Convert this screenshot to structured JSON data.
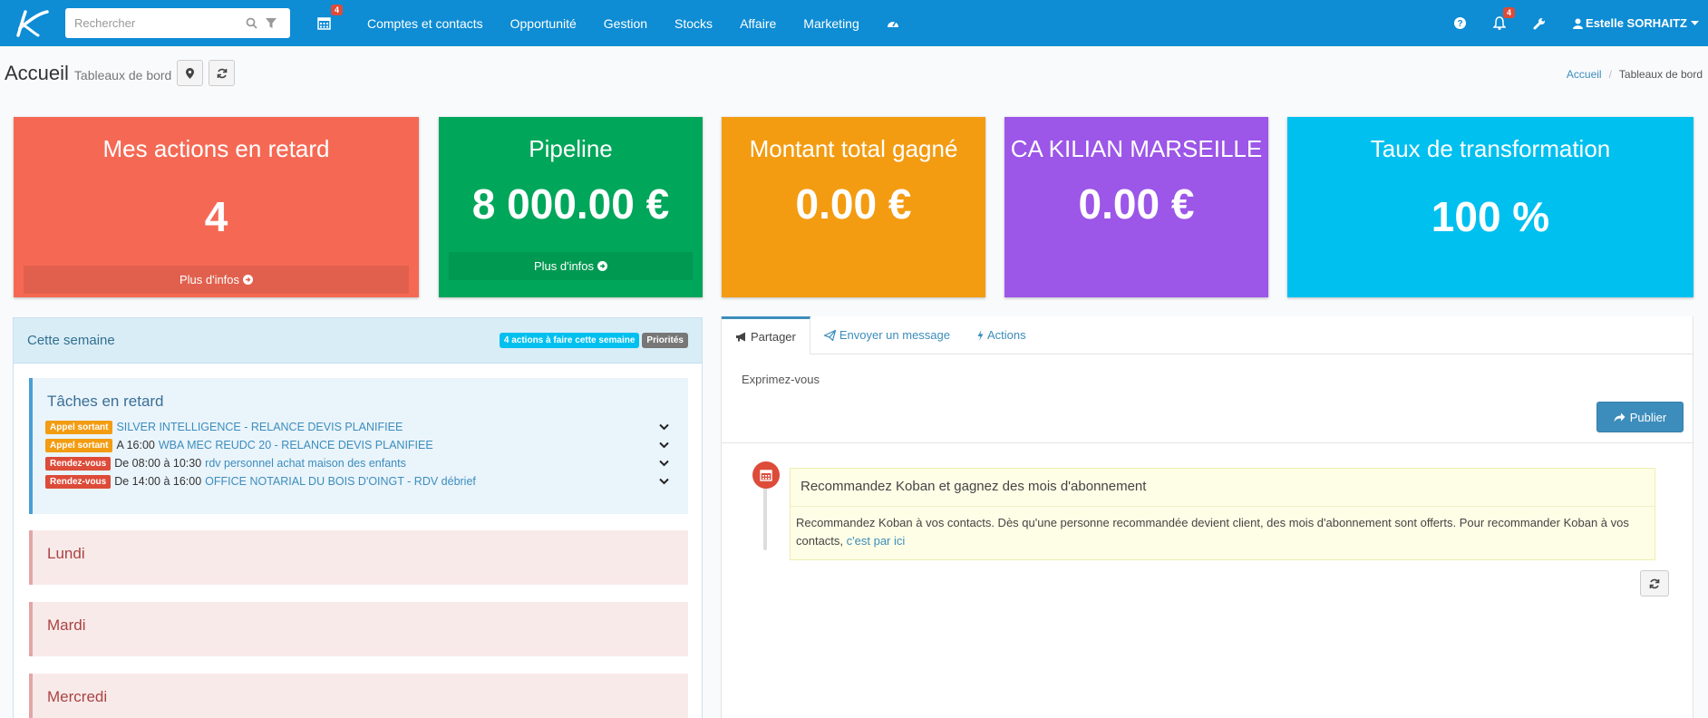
{
  "navbar": {
    "search_placeholder": "Rechercher",
    "calendar_badge": "4",
    "menu": [
      "Comptes et contacts",
      "Opportunité",
      "Gestion",
      "Stocks",
      "Affaire",
      "Marketing"
    ],
    "notif_badge": "4",
    "user_name": "Estelle SORHAITZ"
  },
  "header": {
    "title": "Accueil",
    "subtitle": "Tableaux de bord",
    "breadcrumb_home": "Accueil",
    "breadcrumb_sep": "/",
    "breadcrumb_current": "Tableaux de bord"
  },
  "boxes": [
    {
      "title": "Mes actions en retard",
      "value": "4",
      "more": "Plus d'infos",
      "color": "#f56954"
    },
    {
      "title": "Pipeline",
      "value": "8 000.00 €",
      "more": "Plus d'infos",
      "color": "#00a65a"
    },
    {
      "title": "Montant total gagné",
      "value": "0.00 €",
      "color": "#f39c12"
    },
    {
      "title": "CA KILIAN MARSEILLE",
      "value": "0.00 €",
      "color": "#9c56e8"
    },
    {
      "title": "Taux de transformation",
      "value": "100 %",
      "color": "#00c0ef"
    }
  ],
  "week": {
    "title": "Cette semaine",
    "actions_badge": "4 actions à faire cette semaine",
    "priorities_badge": "Priorités",
    "late_title": "Tâches en retard",
    "tasks": [
      {
        "tag": "Appel sortant",
        "time": "",
        "label": "SILVER INTELLIGENCE - RELANCE DEVIS PLANIFIEE"
      },
      {
        "tag": "Appel sortant",
        "time": "A 16:00",
        "label": "WBA MEC REUDC 20 - RELANCE DEVIS PLANIFIEE"
      },
      {
        "tag": "Rendez-vous",
        "time": "De 08:00 à 10:30",
        "label": "rdv personnel achat maison des enfants"
      },
      {
        "tag": "Rendez-vous",
        "time": "De 14:00 à 16:00",
        "label": "OFFICE NOTARIAL DU BOIS D'OINGT - RDV débrief"
      }
    ],
    "days": [
      "Lundi",
      "Mardi",
      "Mercredi"
    ]
  },
  "share": {
    "tabs": [
      "Partager",
      "Envoyer un message",
      "Actions"
    ],
    "express_placeholder": "Exprimez-vous",
    "publish_label": "Publier",
    "item_title": "Recommandez Koban et gagnez des mois d'abonnement",
    "item_body": "Recommandez Koban à vos contacts. Dès qu'une personne recommandée devient client, des mois d'abonnement sont offerts. Pour recommander Koban à vos contacts,",
    "item_link": "c'est par ici"
  }
}
